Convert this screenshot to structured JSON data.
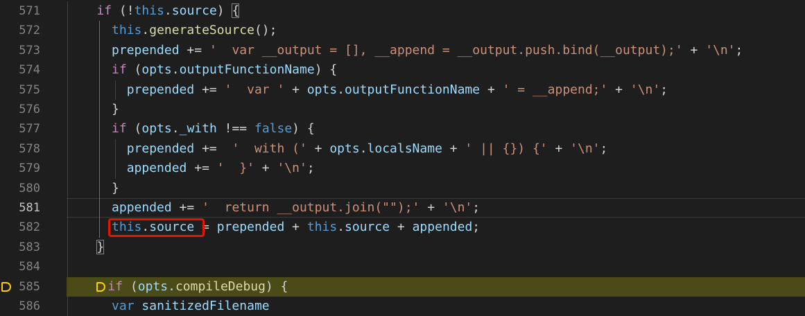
{
  "colors": {
    "background": "#1e1e1e",
    "keyword_control": "#c586c0",
    "keyword_storage": "#569cd6",
    "variable": "#9cdcfe",
    "function": "#dcdcaa",
    "string": "#ce9178",
    "punctuation": "#d4d4d4",
    "line_number": "#858585",
    "debug_line": "#4b4b18",
    "highlight_box": "#e51400",
    "breakpoint": "#ffcc00"
  },
  "editor": {
    "lines": [
      {
        "number": "571",
        "tokens": [
          {
            "t": "    ",
            "c": "punctuation"
          },
          {
            "t": "if",
            "c": "keyword_control"
          },
          {
            "t": " (!",
            "c": "punctuation"
          },
          {
            "t": "this",
            "c": "keyword_storage"
          },
          {
            "t": ".",
            "c": "punctuation"
          },
          {
            "t": "source",
            "c": "variable"
          },
          {
            "t": ") ",
            "c": "punctuation"
          },
          {
            "t": "{",
            "c": "punctuation",
            "bracket": true
          }
        ]
      },
      {
        "number": "572",
        "tokens": [
          {
            "t": "      ",
            "c": "punctuation"
          },
          {
            "t": "this",
            "c": "keyword_storage"
          },
          {
            "t": ".",
            "c": "punctuation"
          },
          {
            "t": "generateSource",
            "c": "function"
          },
          {
            "t": "();",
            "c": "punctuation"
          }
        ]
      },
      {
        "number": "573",
        "tokens": [
          {
            "t": "      ",
            "c": "punctuation"
          },
          {
            "t": "prepended",
            "c": "variable"
          },
          {
            "t": " += ",
            "c": "punctuation"
          },
          {
            "t": "'  var __output = [], __append = __output.push.bind(__output);'",
            "c": "string"
          },
          {
            "t": " + ",
            "c": "punctuation"
          },
          {
            "t": "'\\n'",
            "c": "string"
          },
          {
            "t": ";",
            "c": "punctuation"
          }
        ]
      },
      {
        "number": "574",
        "tokens": [
          {
            "t": "      ",
            "c": "punctuation"
          },
          {
            "t": "if",
            "c": "keyword_control"
          },
          {
            "t": " (",
            "c": "punctuation"
          },
          {
            "t": "opts",
            "c": "variable"
          },
          {
            "t": ".",
            "c": "punctuation"
          },
          {
            "t": "outputFunctionName",
            "c": "variable"
          },
          {
            "t": ") {",
            "c": "punctuation"
          }
        ]
      },
      {
        "number": "575",
        "tokens": [
          {
            "t": "        ",
            "c": "punctuation"
          },
          {
            "t": "prepended",
            "c": "variable"
          },
          {
            "t": " += ",
            "c": "punctuation"
          },
          {
            "t": "'  var '",
            "c": "string"
          },
          {
            "t": " + ",
            "c": "punctuation"
          },
          {
            "t": "opts",
            "c": "variable"
          },
          {
            "t": ".",
            "c": "punctuation"
          },
          {
            "t": "outputFunctionName",
            "c": "variable"
          },
          {
            "t": " + ",
            "c": "punctuation"
          },
          {
            "t": "' = __append;'",
            "c": "string"
          },
          {
            "t": " + ",
            "c": "punctuation"
          },
          {
            "t": "'\\n'",
            "c": "string"
          },
          {
            "t": ";",
            "c": "punctuation"
          }
        ]
      },
      {
        "number": "576",
        "tokens": [
          {
            "t": "      ",
            "c": "punctuation"
          },
          {
            "t": "}",
            "c": "punctuation"
          }
        ]
      },
      {
        "number": "577",
        "tokens": [
          {
            "t": "      ",
            "c": "punctuation"
          },
          {
            "t": "if",
            "c": "keyword_control"
          },
          {
            "t": " (",
            "c": "punctuation"
          },
          {
            "t": "opts",
            "c": "variable"
          },
          {
            "t": ".",
            "c": "punctuation"
          },
          {
            "t": "_with",
            "c": "variable"
          },
          {
            "t": " !== ",
            "c": "punctuation"
          },
          {
            "t": "false",
            "c": "keyword_storage"
          },
          {
            "t": ") {",
            "c": "punctuation"
          }
        ]
      },
      {
        "number": "578",
        "tokens": [
          {
            "t": "        ",
            "c": "punctuation"
          },
          {
            "t": "prepended",
            "c": "variable"
          },
          {
            "t": " +=  ",
            "c": "punctuation"
          },
          {
            "t": "'  with ('",
            "c": "string"
          },
          {
            "t": " + ",
            "c": "punctuation"
          },
          {
            "t": "opts",
            "c": "variable"
          },
          {
            "t": ".",
            "c": "punctuation"
          },
          {
            "t": "localsName",
            "c": "variable"
          },
          {
            "t": " + ",
            "c": "punctuation"
          },
          {
            "t": "' || {}) {'",
            "c": "string"
          },
          {
            "t": " + ",
            "c": "punctuation"
          },
          {
            "t": "'\\n'",
            "c": "string"
          },
          {
            "t": ";",
            "c": "punctuation"
          }
        ]
      },
      {
        "number": "579",
        "tokens": [
          {
            "t": "        ",
            "c": "punctuation"
          },
          {
            "t": "appended",
            "c": "variable"
          },
          {
            "t": " += ",
            "c": "punctuation"
          },
          {
            "t": "'  }'",
            "c": "string"
          },
          {
            "t": " + ",
            "c": "punctuation"
          },
          {
            "t": "'\\n'",
            "c": "string"
          },
          {
            "t": ";",
            "c": "punctuation"
          }
        ]
      },
      {
        "number": "580",
        "tokens": [
          {
            "t": "      ",
            "c": "punctuation"
          },
          {
            "t": "}",
            "c": "punctuation"
          }
        ]
      },
      {
        "number": "581",
        "current": true,
        "tokens": [
          {
            "t": "      ",
            "c": "punctuation"
          },
          {
            "t": "appended",
            "c": "variable"
          },
          {
            "t": " += ",
            "c": "punctuation"
          },
          {
            "t": "'  return __output.join(\"\");'",
            "c": "string"
          },
          {
            "t": " + ",
            "c": "punctuation"
          },
          {
            "t": "'\\n'",
            "c": "string"
          },
          {
            "t": ";",
            "c": "punctuation"
          }
        ]
      },
      {
        "number": "582",
        "tokens": [
          {
            "t": "      ",
            "c": "punctuation"
          },
          {
            "t": "this",
            "c": "keyword_storage"
          },
          {
            "t": ".",
            "c": "punctuation"
          },
          {
            "t": "source",
            "c": "variable"
          },
          {
            "t": " = ",
            "c": "punctuation"
          },
          {
            "t": "prepended",
            "c": "variable"
          },
          {
            "t": " + ",
            "c": "punctuation"
          },
          {
            "t": "this",
            "c": "keyword_storage"
          },
          {
            "t": ".",
            "c": "punctuation"
          },
          {
            "t": "source",
            "c": "variable"
          },
          {
            "t": " + ",
            "c": "punctuation"
          },
          {
            "t": "appended",
            "c": "variable"
          },
          {
            "t": ";",
            "c": "punctuation"
          }
        ]
      },
      {
        "number": "583",
        "tokens": [
          {
            "t": "    ",
            "c": "punctuation"
          },
          {
            "t": "}",
            "c": "punctuation",
            "bracket": true
          }
        ]
      },
      {
        "number": "584",
        "tokens": []
      },
      {
        "number": "585",
        "debug": true,
        "tokens": [
          {
            "t": "    ",
            "c": "punctuation"
          },
          {
            "t": "if",
            "c": "keyword_control"
          },
          {
            "t": " (",
            "c": "punctuation"
          },
          {
            "t": "opts",
            "c": "variable"
          },
          {
            "t": ".",
            "c": "punctuation"
          },
          {
            "t": "compileDebug",
            "c": "function"
          },
          {
            "t": ") {",
            "c": "punctuation"
          }
        ]
      },
      {
        "number": "586",
        "tokens": [
          {
            "t": "      ",
            "c": "punctuation"
          },
          {
            "t": "var",
            "c": "keyword_storage"
          },
          {
            "t": " ",
            "c": "punctuation"
          },
          {
            "t": "sanitizedFilename",
            "c": "variable"
          }
        ]
      }
    ]
  }
}
